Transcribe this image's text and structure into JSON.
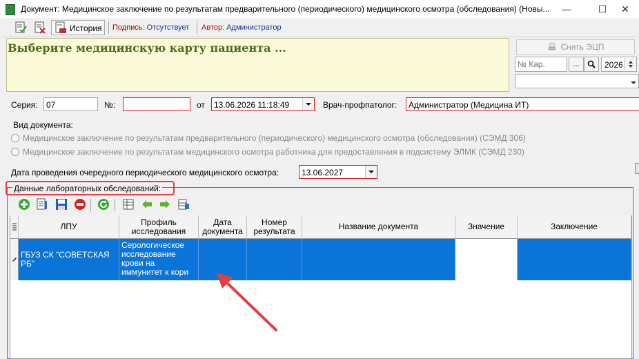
{
  "window": {
    "title": "Документ: Медицинское заключение по результатам предварительного (периодического) медицинского осмотра (обследования) (Новы...",
    "controls": [
      "—",
      "☐",
      "✕"
    ]
  },
  "toolbar": {
    "history_label": "История",
    "signature_label": "Подпись:",
    "signature_value": "Отсутствует",
    "author_label": "Автор:",
    "author_value": "Администратор"
  },
  "patient_card": {
    "title": "Выберите медицинскую карту пациента ..."
  },
  "right_panel": {
    "remove_ecp_label": "Снять ЭЦП",
    "card_number_placeholder": "№ Кар.",
    "ellipsis_label": "...",
    "year_value": "2026",
    "extra_value": ""
  },
  "doc_fields": {
    "series_label": "Серия:",
    "series_value": "07",
    "number_label": "№:",
    "number_value": "",
    "from_label": "от",
    "date_value": "13.06.2026 11:18:49",
    "doctor_label": "Врач-профпатолог:",
    "doctor_value": "Администратор (Медицина ИТ)"
  },
  "doc_type": {
    "label": "Вид документа:",
    "options": [
      "Медицинское заключение по результатам предварительного (периодического) медицинского осмотра (обследования) (СЭМД 306)",
      "Медицинское заключение по результатам медицинского осмотра работника для предоставления в подсистему ЭЛМК (СЭМД 230)"
    ]
  },
  "next_exam": {
    "label": "Дата проведения очередного периодического медицинского осмотра:",
    "value": "13.06.2027"
  },
  "lab_group": {
    "title": "Данные лабораторных обследований:",
    "columns": [
      "ЛПУ",
      "Профиль исследования",
      "Дата документа",
      "Номер результата",
      "Название документа",
      "Значение",
      "Заключение"
    ],
    "rows": [
      {
        "lpu": "ГБУЗ СК \"СОВЕТСКАЯ РБ\"",
        "profile": "Серологическое исследование крови на иммунитет к кори",
        "date": "",
        "number": "",
        "doc_name": "",
        "value": "",
        "conclusion": ""
      }
    ]
  },
  "colors": {
    "selection": "#0a74d9",
    "required_border": "#d42020",
    "annotation": "#e04040",
    "card_bg": "#fbfbd9",
    "card_title": "#4d6a1f"
  }
}
